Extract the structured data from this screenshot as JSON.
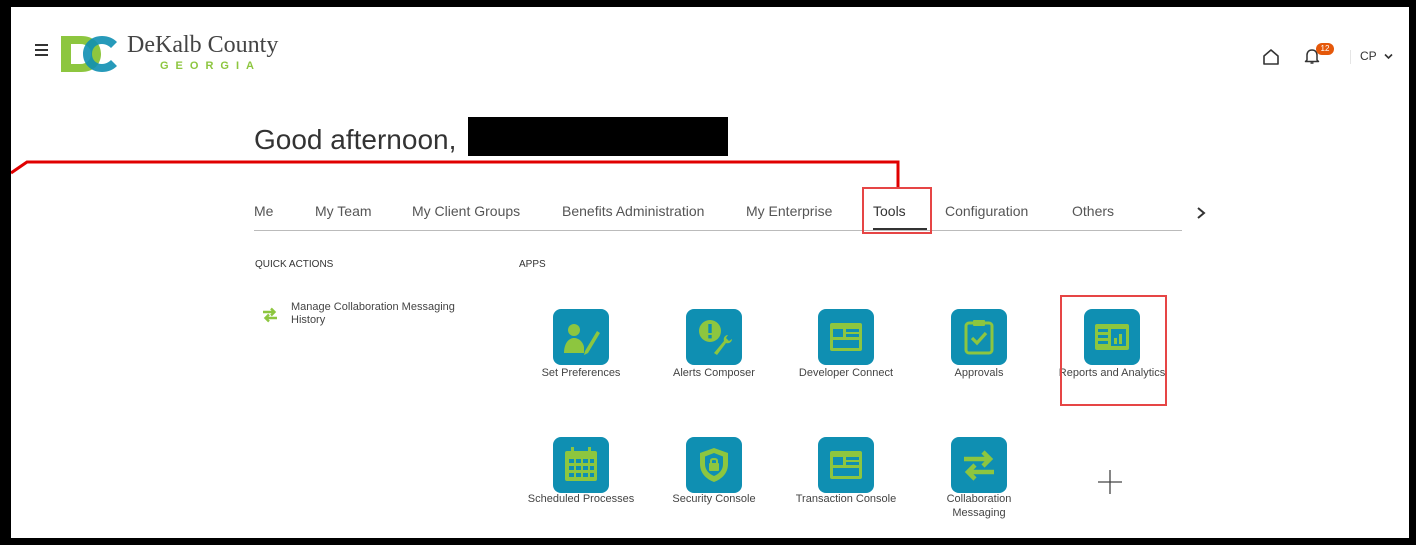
{
  "header": {
    "brand_name": "DeKalb County",
    "brand_sub": "GEORGIA",
    "notification_count": "12",
    "user_initials": "CP"
  },
  "greeting": "Good afternoon,",
  "tabs": [
    {
      "label": "Me"
    },
    {
      "label": "My Team"
    },
    {
      "label": "My Client Groups"
    },
    {
      "label": "Benefits Administration"
    },
    {
      "label": "My Enterprise"
    },
    {
      "label": "Tools"
    },
    {
      "label": "Configuration"
    },
    {
      "label": "Others"
    }
  ],
  "active_tab": "Tools",
  "quick_actions": {
    "heading": "QUICK ACTIONS",
    "items": [
      {
        "label": "Manage Collaboration Messaging History",
        "icon": "swap-arrows-icon"
      }
    ]
  },
  "apps": {
    "heading": "APPS",
    "items": [
      {
        "label": "Set Preferences",
        "icon": "person-pencil-icon"
      },
      {
        "label": "Alerts Composer",
        "icon": "alert-wrench-icon"
      },
      {
        "label": "Developer Connect",
        "icon": "browser-window-icon"
      },
      {
        "label": "Approvals",
        "icon": "clipboard-check-icon"
      },
      {
        "label": "Reports and Analytics",
        "icon": "report-chart-icon"
      },
      {
        "label": "Scheduled Processes",
        "icon": "calendar-icon"
      },
      {
        "label": "Security Console",
        "icon": "shield-lock-icon"
      },
      {
        "label": "Transaction Console",
        "icon": "browser-window-icon"
      },
      {
        "label": "Collaboration Messaging",
        "icon": "swap-arrows-icon"
      }
    ]
  },
  "colors": {
    "tile": "#0f8fb2",
    "icon_green": "#8dc63f",
    "highlight_red": "#e64545",
    "annotation_red": "#e00000",
    "badge": "#e5580a"
  }
}
